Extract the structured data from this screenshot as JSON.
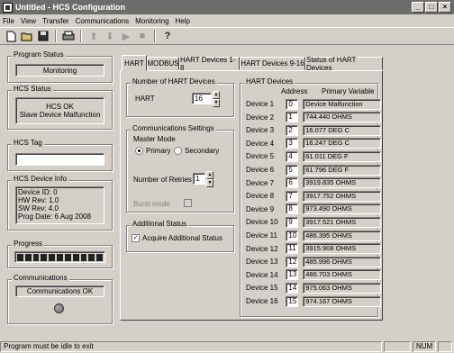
{
  "window": {
    "title": "Untitled - HCS Configuration"
  },
  "menu": [
    "File",
    "View",
    "Transfer",
    "Communications",
    "Monitoring",
    "Help"
  ],
  "left": {
    "program_status": {
      "label": "Program Status",
      "value": "Monitoring"
    },
    "hcs_status": {
      "label": "HCS Status",
      "line1": "HCS OK",
      "line2": "Slave Device Malfunction"
    },
    "hcs_tag": {
      "label": "HCS Tag",
      "value": ""
    },
    "device_info": {
      "label": "HCS Device Info",
      "lines": [
        "Device ID: 0",
        "HW Rev: 1.0",
        "SW Rev: 4.0",
        "Prog Date: 6 Aug 2008"
      ]
    },
    "progress": {
      "label": "Progress",
      "percent": 100
    },
    "communications": {
      "label": "Communications",
      "value": "Communications OK",
      "led_color": "#6b6b6b"
    }
  },
  "tabs": [
    "HART",
    "MODBUS",
    "HART Devices 1-8",
    "HART Devices 9-16",
    "Status of HART Devices"
  ],
  "active_tab": 0,
  "hart": {
    "num_devices": {
      "label": "Number of HART Devices",
      "field_label": "HART",
      "value": "16"
    },
    "comm": {
      "label": "Communications Settings",
      "master_mode_label": "Master Mode",
      "primary_label": "Primary",
      "secondary_label": "Secondary",
      "retries_label": "Number of Retries",
      "retries_value": "1",
      "burst_label": "Burst mode"
    },
    "additional": {
      "label": "Additional Status",
      "checkbox_label": "Acquire Additional Status",
      "checked": true
    },
    "devices": {
      "label": "HART Devices",
      "col_address": "Address",
      "col_pv": "Primary Variable",
      "rows": [
        {
          "name": "Device 1",
          "address": "0",
          "pv": "Device Malfunction"
        },
        {
          "name": "Device 2",
          "address": "1",
          "pv": "744.440 OHMS"
        },
        {
          "name": "Device 3",
          "address": "2",
          "pv": "16.077 DEG C"
        },
        {
          "name": "Device 4",
          "address": "3",
          "pv": "16.247 DEG C"
        },
        {
          "name": "Device 5",
          "address": "4",
          "pv": "61.011 DEG F"
        },
        {
          "name": "Device 6",
          "address": "5",
          "pv": "61.796 DEG F"
        },
        {
          "name": "Device 7",
          "address": "6",
          "pv": "3919.835 OHMS"
        },
        {
          "name": "Device 8",
          "address": "7",
          "pv": "3917.752 OHMS"
        },
        {
          "name": "Device 9",
          "address": "8",
          "pv": "973.490 OHMS"
        },
        {
          "name": "Device 10",
          "address": "9",
          "pv": "3917.521 OHMS"
        },
        {
          "name": "Device 11",
          "address": "10",
          "pv": "486.395 OHMS"
        },
        {
          "name": "Device 12",
          "address": "11",
          "pv": "3915.908 OHMS"
        },
        {
          "name": "Device 13",
          "address": "12",
          "pv": "485.996 OHMS"
        },
        {
          "name": "Device 14",
          "address": "13",
          "pv": "486.703 OHMS"
        },
        {
          "name": "Device 15",
          "address": "14",
          "pv": "975.063 OHMS"
        },
        {
          "name": "Device 16",
          "address": "15",
          "pv": "974.167 OHMS"
        }
      ]
    }
  },
  "status_bar": {
    "message": "Program must be idle to exit",
    "num": "NUM"
  }
}
